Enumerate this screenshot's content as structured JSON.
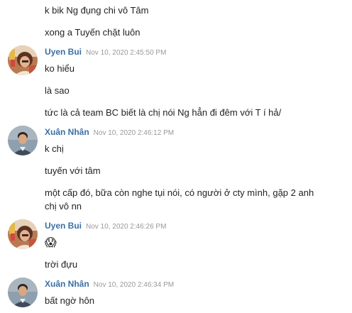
{
  "messages": {
    "m1": "k bik Ng đụng chi vô Tâm",
    "m2": "xong a Tuyến chặt luôn",
    "g1": {
      "author": "Uyen Bui",
      "time": "Nov 10, 2020 2:45:50 PM",
      "m1": "ko hiểu",
      "m2": "là sao",
      "m3": "tức là cả team BC biết là chị nói Ng hẳn đi đêm với T í hả/"
    },
    "g2": {
      "author": "Xuân Nhân",
      "time": "Nov 10, 2020 2:46:12 PM",
      "m1": "k chị",
      "m2": "tuyến với tâm",
      "m3": "một cấp đó, bữa còn nghe tụi nói, có người ở cty mình, gặp 2 anh chị vô nn"
    },
    "g3": {
      "author": "Uyen Bui",
      "time": "Nov 10, 2020 2:46:26 PM",
      "emoji": "😱",
      "m2": "trời đựu"
    },
    "g4": {
      "author": "Xuân Nhân",
      "time": "Nov 10, 2020 2:46:34 PM",
      "m1": "bất ngờ hôn"
    }
  },
  "avatars": {
    "uyen": "woman-avatar",
    "nhan": "man-avatar"
  },
  "colors": {
    "author": "#3a6fa5",
    "timestamp": "#999999",
    "text": "#222222"
  }
}
